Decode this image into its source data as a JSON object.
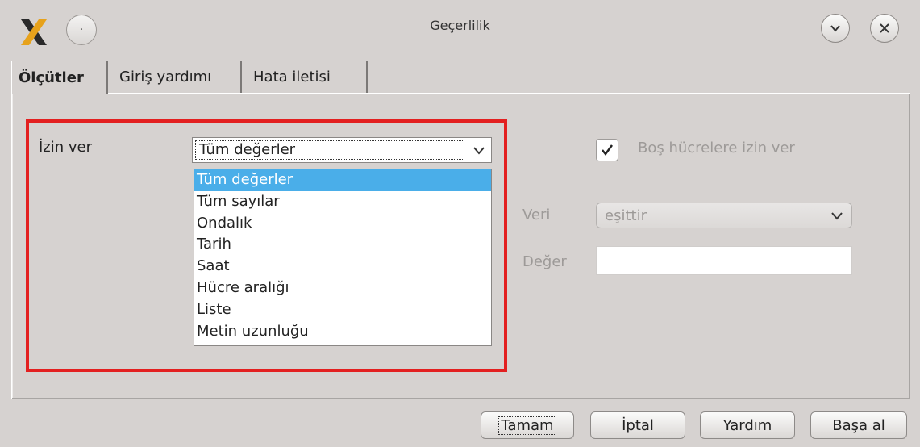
{
  "window": {
    "title": "Geçerlilik",
    "menu_glyph": "·"
  },
  "tabs": [
    {
      "label": "Ölçütler",
      "active": true
    },
    {
      "label": "Giriş yardımı",
      "active": false
    },
    {
      "label": "Hata iletisi",
      "active": false
    }
  ],
  "criteria": {
    "allow_label": "İzin ver",
    "allow_selected": "Tüm değerler",
    "allow_options": [
      "Tüm değerler",
      "Tüm sayılar",
      "Ondalık",
      "Tarih",
      "Saat",
      "Hücre aralığı",
      "Liste",
      "Metin uzunluğu"
    ],
    "allow_empty_label": "Boş hücrelere izin ver",
    "allow_empty_checked": true,
    "data_label": "Veri",
    "data_value": "eşittir",
    "value_label": "Değer",
    "value_text": ""
  },
  "buttons": {
    "ok": "Tamam",
    "cancel": "İptal",
    "help": "Yardım",
    "reset": "Başa al"
  },
  "colors": {
    "highlight": "#e32020",
    "selection": "#4aaee9"
  }
}
